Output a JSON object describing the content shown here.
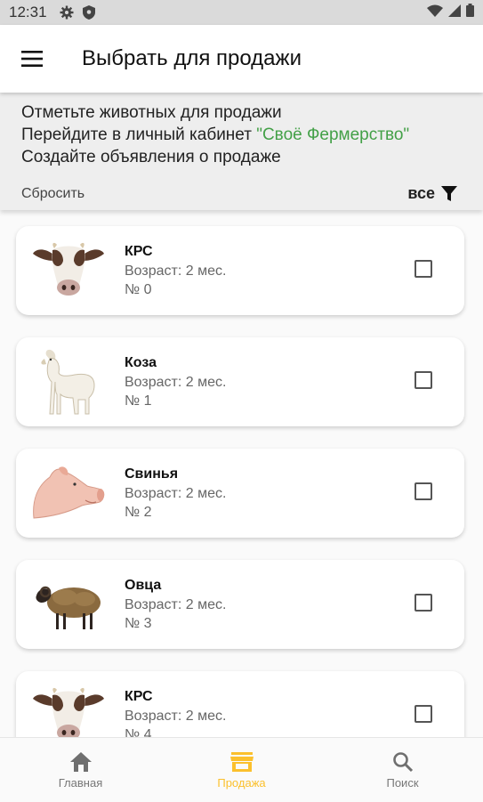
{
  "status_bar": {
    "time": "12:31"
  },
  "app_bar": {
    "title": "Выбрать для продажи"
  },
  "info": {
    "line1": "Отметьте животных для продажи",
    "line2_prefix": "Перейдите в личный кабинет ",
    "line2_brand": "\"Своё Фермерство\"",
    "line3": "Создайте объявления о продаже",
    "reset_label": "Сбросить",
    "filter_label": "все",
    "brand_color": "#43a047"
  },
  "animals": [
    {
      "name": "КРС",
      "age": "Возраст: 2 мес.",
      "number": "№ 0",
      "icon": "cow-icon",
      "checked": false
    },
    {
      "name": "Коза",
      "age": "Возраст: 2 мес.",
      "number": "№ 1",
      "icon": "goat-icon",
      "checked": false
    },
    {
      "name": "Свинья",
      "age": "Возраст: 2 мес.",
      "number": "№ 2",
      "icon": "pig-icon",
      "checked": false
    },
    {
      "name": "Овца",
      "age": "Возраст: 2 мес.",
      "number": "№ 3",
      "icon": "sheep-icon",
      "checked": false
    },
    {
      "name": "КРС",
      "age": "Возраст: 2 мес.",
      "number": "№ 4",
      "icon": "cow-icon",
      "checked": false
    }
  ],
  "bottom_nav": {
    "items": [
      {
        "label": "Главная",
        "icon": "home-icon",
        "active": false
      },
      {
        "label": "Продажа",
        "icon": "store-icon",
        "active": true
      },
      {
        "label": "Поиск",
        "icon": "search-icon",
        "active": false
      }
    ],
    "active_color": "#fbc02d"
  }
}
